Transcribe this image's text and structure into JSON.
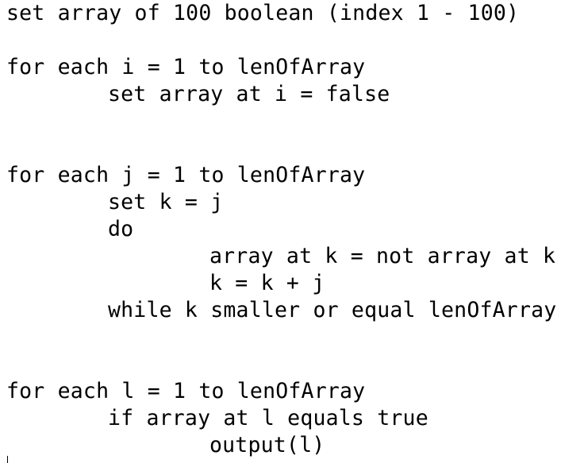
{
  "document": {
    "lines": [
      "set array of 100 boolean (index 1 - 100)",
      "for each i = 1 to lenOfArray",
      "set array at i = false",
      "for each j = 1 to lenOfArray",
      "set k = j",
      "do",
      "array at k = not array at k",
      "k = k + j",
      "while k smaller or equal lenOfArray",
      "for each l = 1 to lenOfArray",
      "if array at l equals true",
      "output(l)"
    ]
  }
}
